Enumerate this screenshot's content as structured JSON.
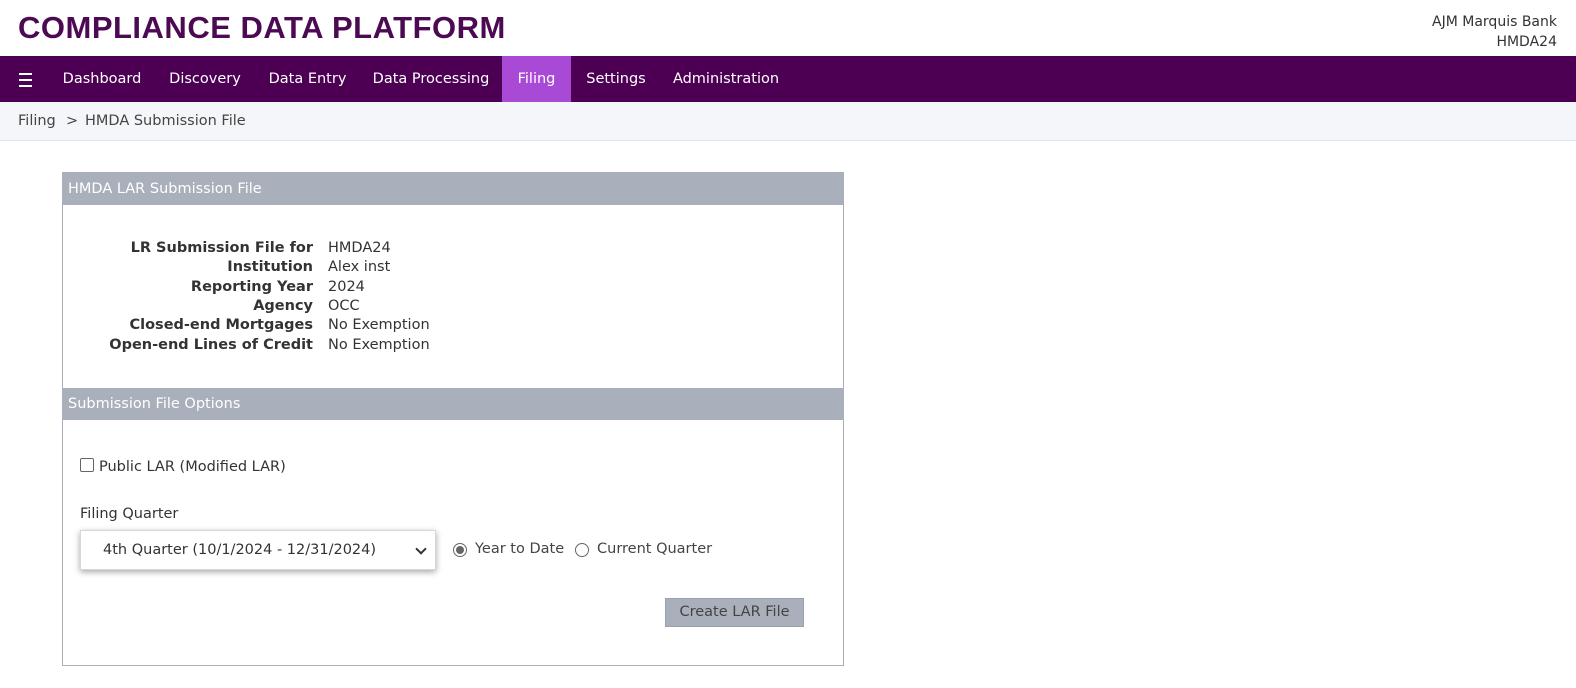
{
  "header": {
    "brand": "COMPLIANCE DATA PLATFORM",
    "org_name": "AJM Marquis Bank",
    "org_code": "HMDA24"
  },
  "nav": {
    "menu_icon": "hamburger-icon",
    "items": [
      {
        "label": "Dashboard"
      },
      {
        "label": "Discovery"
      },
      {
        "label": "Data Entry"
      },
      {
        "label": "Data Processing"
      },
      {
        "label": "Filing",
        "active": true
      },
      {
        "label": "Settings"
      },
      {
        "label": "Administration"
      }
    ],
    "active_color": "#a94ad7",
    "bar_color": "#4d0053"
  },
  "breadcrumb": {
    "items": [
      "Filing",
      "HMDA Submission File"
    ],
    "separator": ">"
  },
  "panel": {
    "title": "HMDA LAR Submission File",
    "info": [
      {
        "label": "LR Submission File for",
        "value": "HMDA24"
      },
      {
        "label": "Institution",
        "value": "Alex inst"
      },
      {
        "label": "Reporting Year",
        "value": "2024"
      },
      {
        "label": "Agency",
        "value": "OCC"
      },
      {
        "label": "Closed-end Mortgages",
        "value": "No Exemption"
      },
      {
        "label": "Open-end Lines of Credit",
        "value": "No Exemption"
      }
    ],
    "options_title": "Submission File Options",
    "public_lar_label": "Public LAR (Modified LAR)",
    "public_lar_checked": false,
    "filing_quarter_label": "Filing Quarter",
    "filing_quarter_value": "4th Quarter (10/1/2024 - 12/31/2024)",
    "radio_ytd_label": "Year to Date",
    "radio_current_label": "Current Quarter",
    "selected_radio": "Year to Date",
    "create_button_label": "Create LAR File"
  }
}
